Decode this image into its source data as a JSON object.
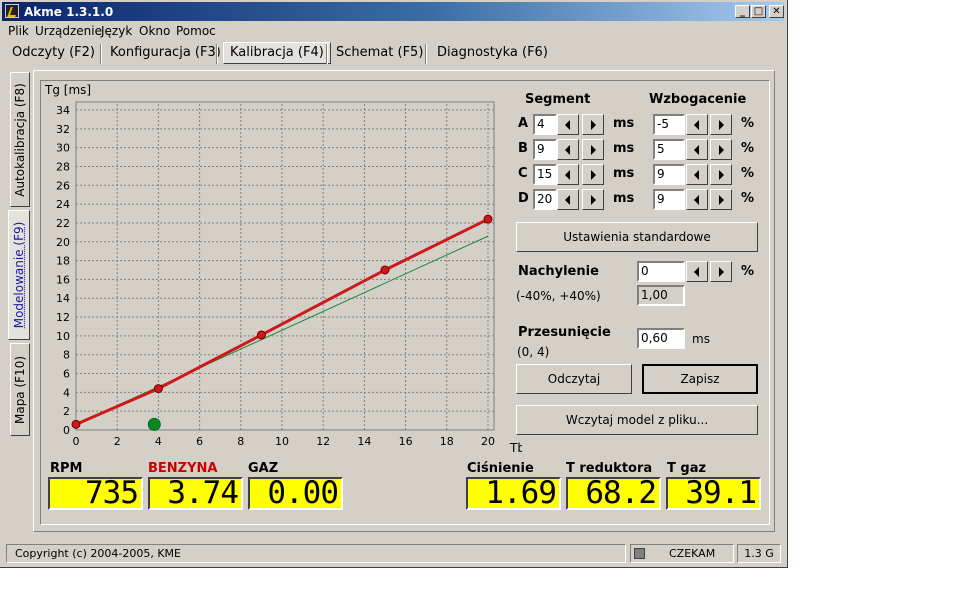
{
  "window": {
    "title": "Akme 1.3.1.0",
    "min": "_",
    "max": "□",
    "close": "✕"
  },
  "menu": [
    "Plik",
    "Urządzenie",
    "Język",
    "Okno",
    "Pomoc"
  ],
  "tabs": [
    "Odczyty (F2)",
    "Konfiguracja (F3)",
    "Kalibracja (F4)",
    "Schemat (F5)",
    "Diagnostyka (F6)"
  ],
  "side_tabs": [
    "Autokalibracja (F8)",
    "Modelowanie (F9)",
    "Mapa (F10)"
  ],
  "segment": {
    "title": "Segment",
    "unit": "ms",
    "rows": [
      {
        "label": "A",
        "value": "4"
      },
      {
        "label": "B",
        "value": "9"
      },
      {
        "label": "C",
        "value": "15"
      },
      {
        "label": "D",
        "value": "20"
      }
    ]
  },
  "wzbogacenie": {
    "title": "Wzbogacenie",
    "unit": "%",
    "values": [
      "-5",
      "5",
      "9",
      "9"
    ]
  },
  "buttons": {
    "standard": "Ustawienia standardowe",
    "read": "Odczytaj",
    "save": "Zapisz",
    "load": "Wczytaj model z pliku..."
  },
  "nachylenie": {
    "label": "Nachylenie",
    "range": "(-40%, +40%)",
    "value": "0",
    "unit": "%",
    "factor": "1,00"
  },
  "przesuniecie": {
    "label": "Przesunięcie",
    "range": "(0, 4)",
    "value": "0,60",
    "unit": "ms"
  },
  "gauges": [
    {
      "label": "RPM",
      "value": "735",
      "color": "#000000"
    },
    {
      "label": "BENZYNA",
      "value": "3.74",
      "color": "#cc0000"
    },
    {
      "label": "GAZ",
      "value": "0.00",
      "color": "#000000"
    },
    {
      "label": "Ciśnienie",
      "value": "1.69",
      "color": "#000000"
    },
    {
      "label": "T reduktora",
      "value": "68.2",
      "color": "#000000"
    },
    {
      "label": "T gaz",
      "value": "39.1",
      "color": "#000000"
    }
  ],
  "status": {
    "copyright": "Copyright (c) 2004-2005, KME",
    "state": "CZEKAM",
    "version": "1.3 G"
  },
  "chart_data": {
    "type": "line",
    "ylabel": "Tg [ms]",
    "xlabel": "Tb [ms]",
    "xlim": [
      0,
      20
    ],
    "ylim": [
      0,
      34
    ],
    "xticks": [
      0,
      2,
      4,
      6,
      8,
      10,
      12,
      14,
      16,
      18,
      20
    ],
    "yticks": [
      0,
      2,
      4,
      6,
      8,
      10,
      12,
      14,
      16,
      18,
      20,
      22,
      24,
      26,
      28,
      30,
      32,
      34
    ],
    "grid": true,
    "series": [
      {
        "color": "#cc1a1a",
        "points": [
          [
            0,
            0.6
          ],
          [
            4,
            4.4
          ],
          [
            9,
            10.1
          ],
          [
            15,
            17.0
          ],
          [
            20,
            22.4
          ]
        ]
      },
      {
        "color": "#1a8a3a",
        "points": [
          [
            0,
            0.6
          ],
          [
            20,
            20.6
          ]
        ]
      }
    ],
    "marker": {
      "x": 3.8,
      "y": 0.6,
      "color": "#0a8a1a"
    }
  }
}
